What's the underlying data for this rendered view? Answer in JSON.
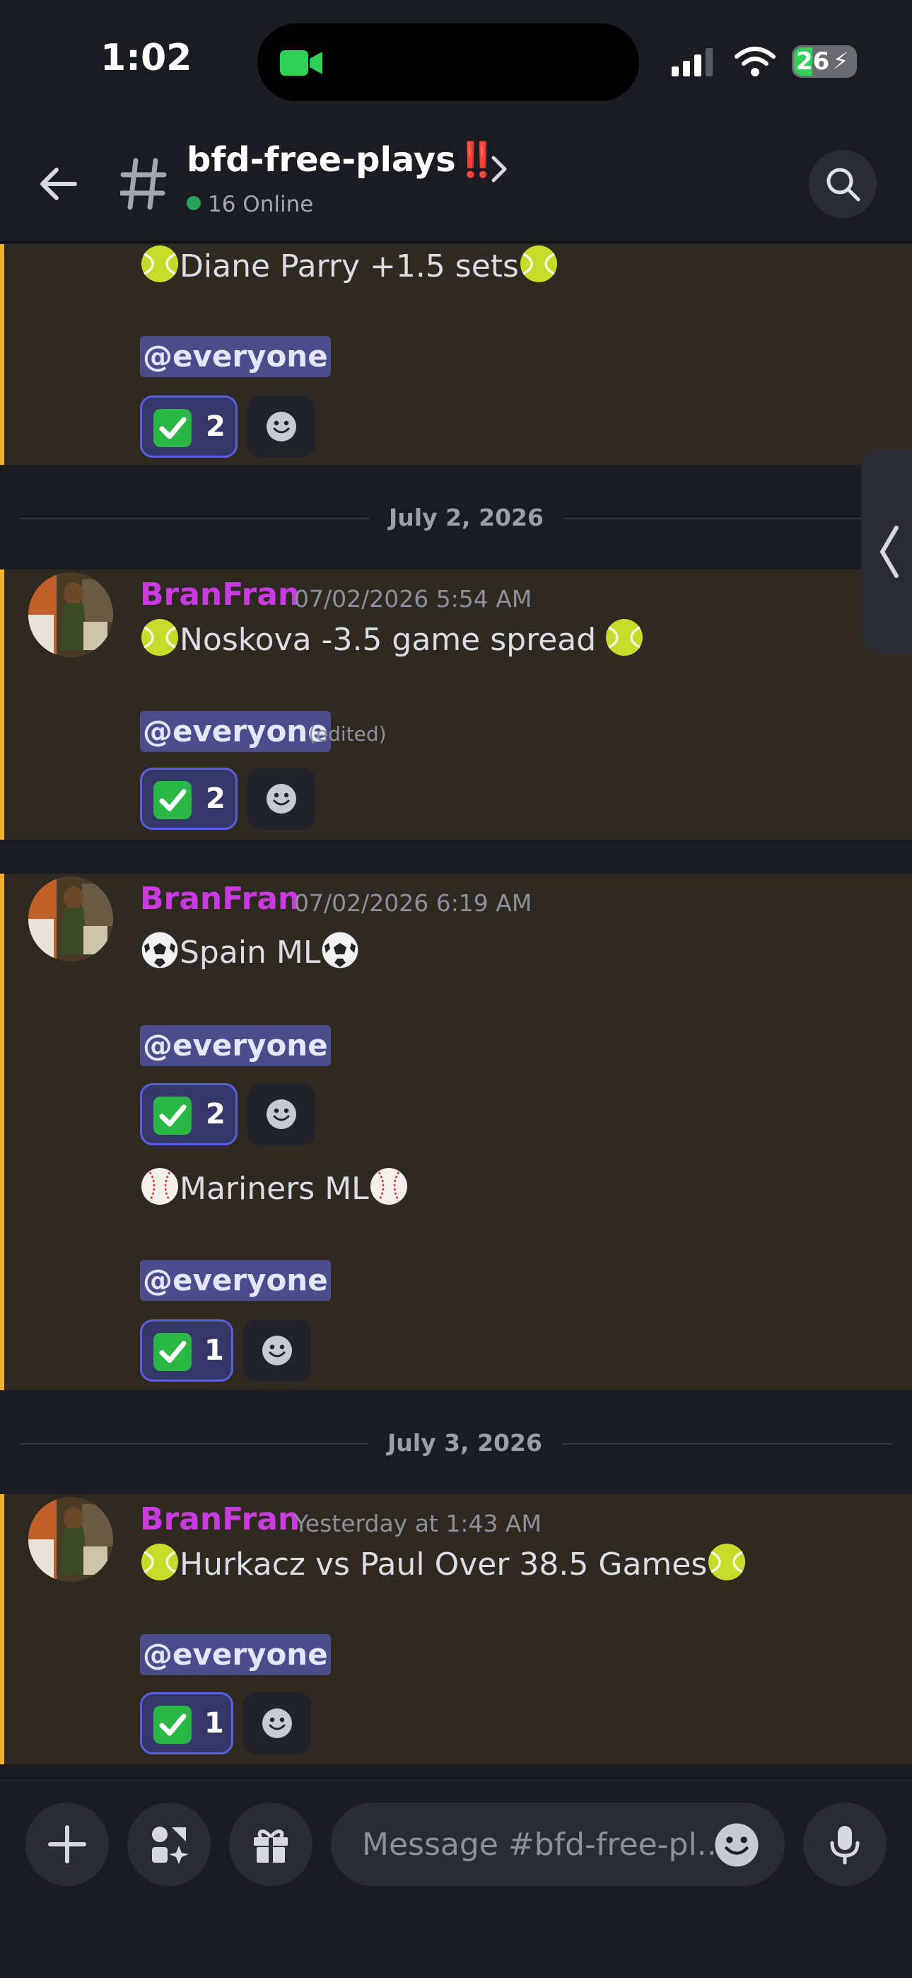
{
  "status_bar": {
    "time": "1:02",
    "battery": "26"
  },
  "header": {
    "channel_name": "bfd-free-plays",
    "channel_suffix": "‼️",
    "online": "16 Online"
  },
  "messages": [
    {
      "author": "",
      "timestamp": "",
      "text": "Diane Parry +1.5 sets",
      "emoji": "tennis-ball",
      "mention": "@everyone",
      "edited": "",
      "reaction_count": "2"
    },
    {
      "author": "BranFran",
      "timestamp": "07/02/2026 5:54 AM",
      "text": "Noskova -3.5 game spread",
      "emoji": "tennis-ball",
      "mention": "@everyone",
      "edited": "(edited)",
      "reaction_count": "2"
    },
    {
      "author": "BranFran",
      "timestamp": "07/02/2026 6:19 AM",
      "text": "Spain ML",
      "emoji": "soccer-ball",
      "mention": "@everyone",
      "edited": "",
      "reaction_count": "2"
    },
    {
      "author": "",
      "timestamp": "",
      "text": "Mariners ML",
      "emoji": "baseball",
      "mention": "@everyone",
      "edited": "",
      "reaction_count": "1"
    },
    {
      "author": "BranFran",
      "timestamp": "Yesterday at 1:43 AM",
      "text": "Hurkacz vs Paul Over 38.5 Games",
      "emoji": "tennis-ball",
      "mention": "@everyone",
      "edited": "",
      "reaction_count": "1"
    }
  ],
  "dividers": [
    "July 2, 2026",
    "July 3, 2026"
  ],
  "composer": {
    "placeholder": "Message #bfd-free-pl..."
  },
  "colors": {
    "accent_bar": "#f0b232",
    "author": "#c93ae0",
    "mention_bg": "#4b4d8a",
    "reaction_border": "#5a5ee0",
    "online_dot": "#24a55a"
  }
}
